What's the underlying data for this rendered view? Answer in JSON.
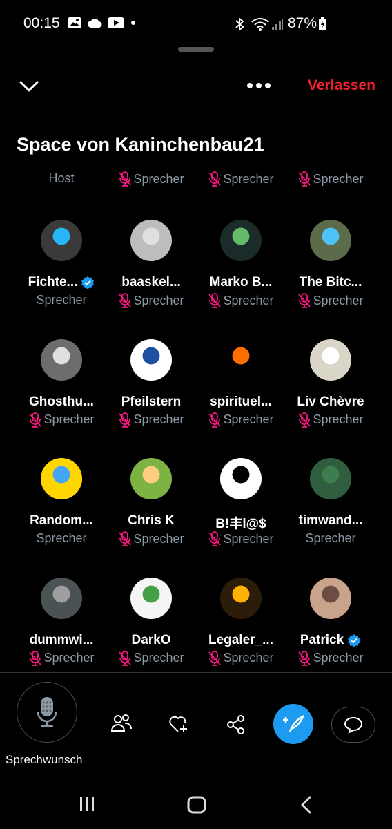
{
  "status_bar": {
    "time": "00:15",
    "battery": "87%"
  },
  "header": {
    "leave_label": "Verlassen"
  },
  "title": "Space von Kaninchenbau21",
  "roles_row": [
    {
      "label": "Host",
      "muted": false
    },
    {
      "label": "Sprecher",
      "muted": true
    },
    {
      "label": "Sprecher",
      "muted": true
    },
    {
      "label": "Sprecher",
      "muted": true
    }
  ],
  "participants": [
    {
      "name": "Fichte...",
      "verified": true,
      "role": "Sprecher",
      "muted": false,
      "avatar_color": "#3a3a3a",
      "avatar_accent": "#29b6f6"
    },
    {
      "name": "baaskel...",
      "verified": false,
      "role": "Sprecher",
      "muted": true,
      "avatar_color": "#bdbdbd",
      "avatar_accent": "#e0e0e0"
    },
    {
      "name": "Marko B...",
      "verified": false,
      "role": "Sprecher",
      "muted": true,
      "avatar_color": "#1b2b2a",
      "avatar_accent": "#66bb6a"
    },
    {
      "name": "The Bitc...",
      "verified": false,
      "role": "Sprecher",
      "muted": true,
      "avatar_color": "#5c6b4a",
      "avatar_accent": "#4fc3f7"
    },
    {
      "name": "Ghosthu...",
      "verified": false,
      "role": "Sprecher",
      "muted": true,
      "avatar_color": "#6d6d6d",
      "avatar_accent": "#e0e0e0"
    },
    {
      "name": "Pfeilstern",
      "verified": false,
      "role": "Sprecher",
      "muted": true,
      "avatar_color": "#ffffff",
      "avatar_accent": "#1e4fa0"
    },
    {
      "name": "spirituel...",
      "verified": false,
      "role": "Sprecher",
      "muted": true,
      "avatar_color": "#000000",
      "avatar_accent": "#ff6d00"
    },
    {
      "name": "Liv Chèvre",
      "verified": false,
      "role": "Sprecher",
      "muted": true,
      "avatar_color": "#d9d5c7",
      "avatar_accent": "#ffffff"
    },
    {
      "name": "Random...",
      "verified": false,
      "role": "Sprecher",
      "muted": false,
      "avatar_color": "#ffd600",
      "avatar_accent": "#42a5f5"
    },
    {
      "name": "Chris K",
      "verified": false,
      "role": "Sprecher",
      "muted": true,
      "avatar_color": "#7cb342",
      "avatar_accent": "#ffcc80"
    },
    {
      "name": "B!丰l@$",
      "verified": false,
      "role": "Sprecher",
      "muted": true,
      "avatar_color": "#ffffff",
      "avatar_accent": "#000000"
    },
    {
      "name": "timwand...",
      "verified": false,
      "role": "Sprecher",
      "muted": false,
      "avatar_color": "#2e5e3e",
      "avatar_accent": "#3f7d4f"
    },
    {
      "name": "dummwi...",
      "verified": false,
      "role": "Sprecher",
      "muted": true,
      "avatar_color": "#4a5254",
      "avatar_accent": "#9e9e9e"
    },
    {
      "name": "DarkO",
      "verified": false,
      "role": "Sprecher",
      "muted": true,
      "avatar_color": "#f5f5f5",
      "avatar_accent": "#43a047"
    },
    {
      "name": "Legaler_...",
      "verified": false,
      "role": "Sprecher",
      "muted": true,
      "avatar_color": "#2b1d0a",
      "avatar_accent": "#ffb300"
    },
    {
      "name": "Patrick",
      "verified": true,
      "role": "Sprecher",
      "muted": true,
      "avatar_color": "#c9a38c",
      "avatar_accent": "#6d4c41"
    }
  ],
  "bottom_bar": {
    "mic_label": "Sprechwunsch"
  },
  "colors": {
    "accent": "#1d9bf0",
    "leave": "#f4212e",
    "muted": "#f91880",
    "secondary_text": "#8b98a5"
  }
}
